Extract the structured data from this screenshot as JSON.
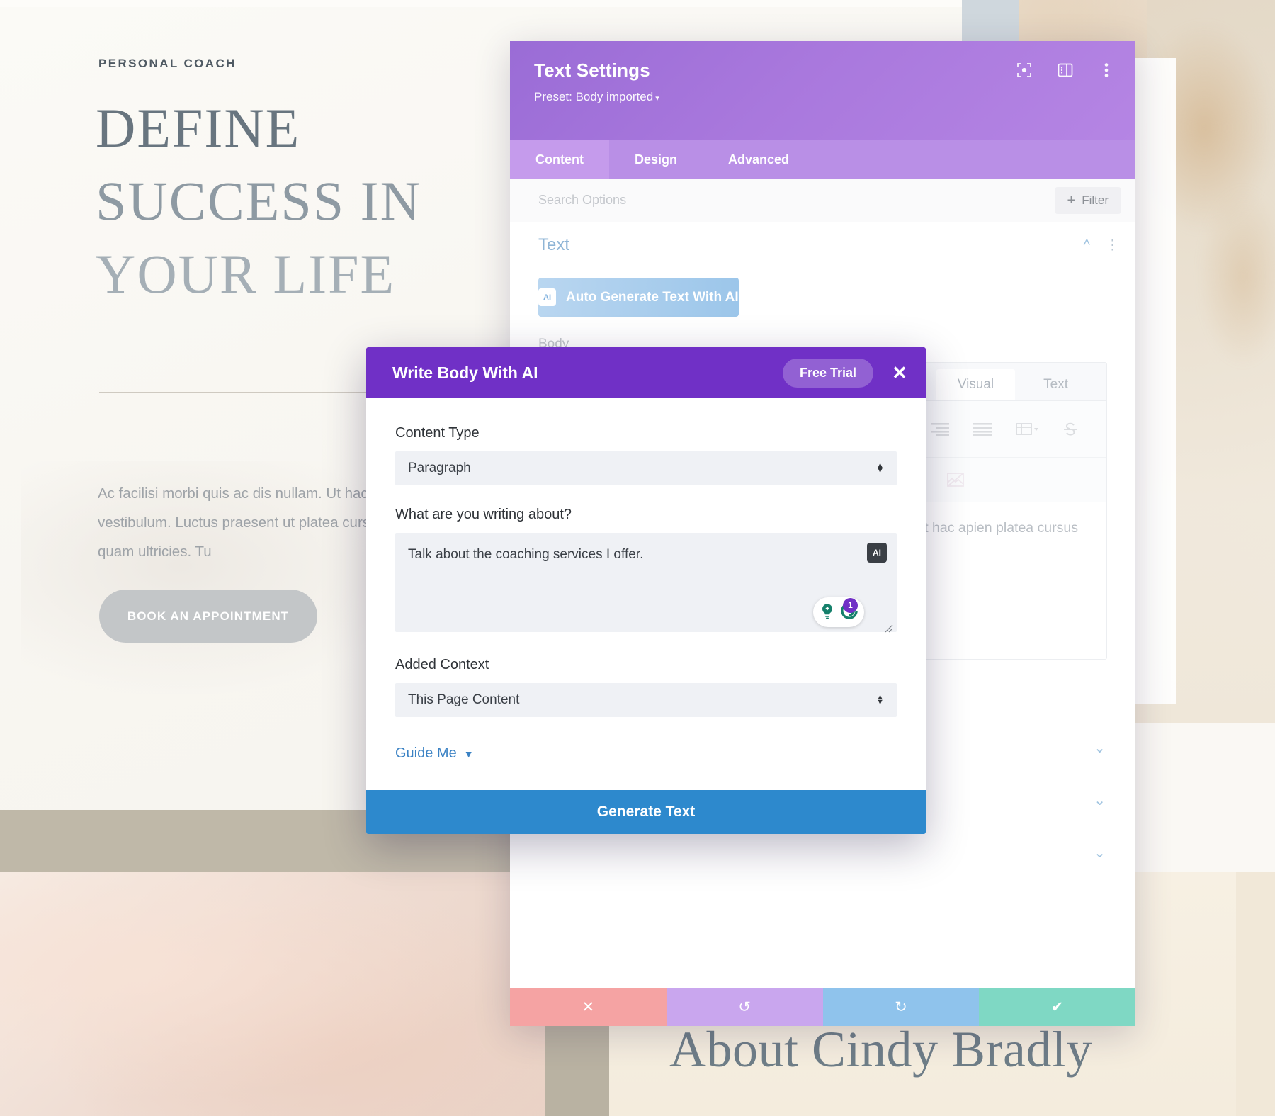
{
  "website": {
    "eyebrow": "PERSONAL COACH",
    "headline_line1": "DEFINE",
    "headline_line2": "SUCCESS IN",
    "headline_line3": "YOUR LIFE",
    "body_paragraph": "Ac facilisi morbi quis ac dis nullam. Ut hac vestibulum. Luctus praesent ut platea cursus quam ultricies. Tu",
    "cta_label": "BOOK AN APPOINTMENT",
    "about_heading": "About Cindy Bradly"
  },
  "divi_panel": {
    "title": "Text Settings",
    "preset": "Preset: Body imported",
    "preset_caret": "▾",
    "header_icons": [
      "focus-icon",
      "layout-panel-icon",
      "kebab-menu-icon"
    ],
    "tabs": [
      {
        "label": "Content",
        "active": true
      },
      {
        "label": "Design",
        "active": false
      },
      {
        "label": "Advanced",
        "active": false
      }
    ],
    "search_placeholder": "Search Options",
    "filter_label": "Filter",
    "filter_plus": "+",
    "section_text_label": "Text",
    "ai_button_label": "Auto Generate Text With AI",
    "ai_button_chip": "AI",
    "body_label": "Body",
    "editor_tabs": [
      {
        "label": "Visual",
        "active": true
      },
      {
        "label": "Text",
        "active": false
      }
    ],
    "editor_content": "ada a volutpat hac\napien platea cursus",
    "footer": [
      {
        "name": "cancel",
        "glyph": "✕",
        "color": "#f5a3a3"
      },
      {
        "name": "undo",
        "glyph": "↺",
        "color": "#c9a6ee"
      },
      {
        "name": "redo",
        "glyph": "↻",
        "color": "#8fc3ec"
      },
      {
        "name": "save",
        "glyph": "✔",
        "color": "#7fd8c4"
      }
    ]
  },
  "ai_modal": {
    "title": "Write Body With AI",
    "trial_label": "Free Trial",
    "close_glyph": "✕",
    "content_type_label": "Content Type",
    "content_type_value": "Paragraph",
    "prompt_label": "What are you writing about?",
    "prompt_value": "Talk about the coaching services I offer.",
    "prompt_ai_chip": "AI",
    "grammarly_badge_count": "1",
    "added_context_label": "Added Context",
    "added_context_value": "This Page Content",
    "guide_me_label": "Guide Me",
    "guide_me_caret": "▼",
    "generate_label": "Generate Text"
  },
  "colors": {
    "divi_header_purple": "#a978dd",
    "modal_purple": "#7030c6",
    "generate_blue": "#2d89cd",
    "ai_button_blue": "#9cc6ea",
    "grammarly_green": "#15806b"
  }
}
